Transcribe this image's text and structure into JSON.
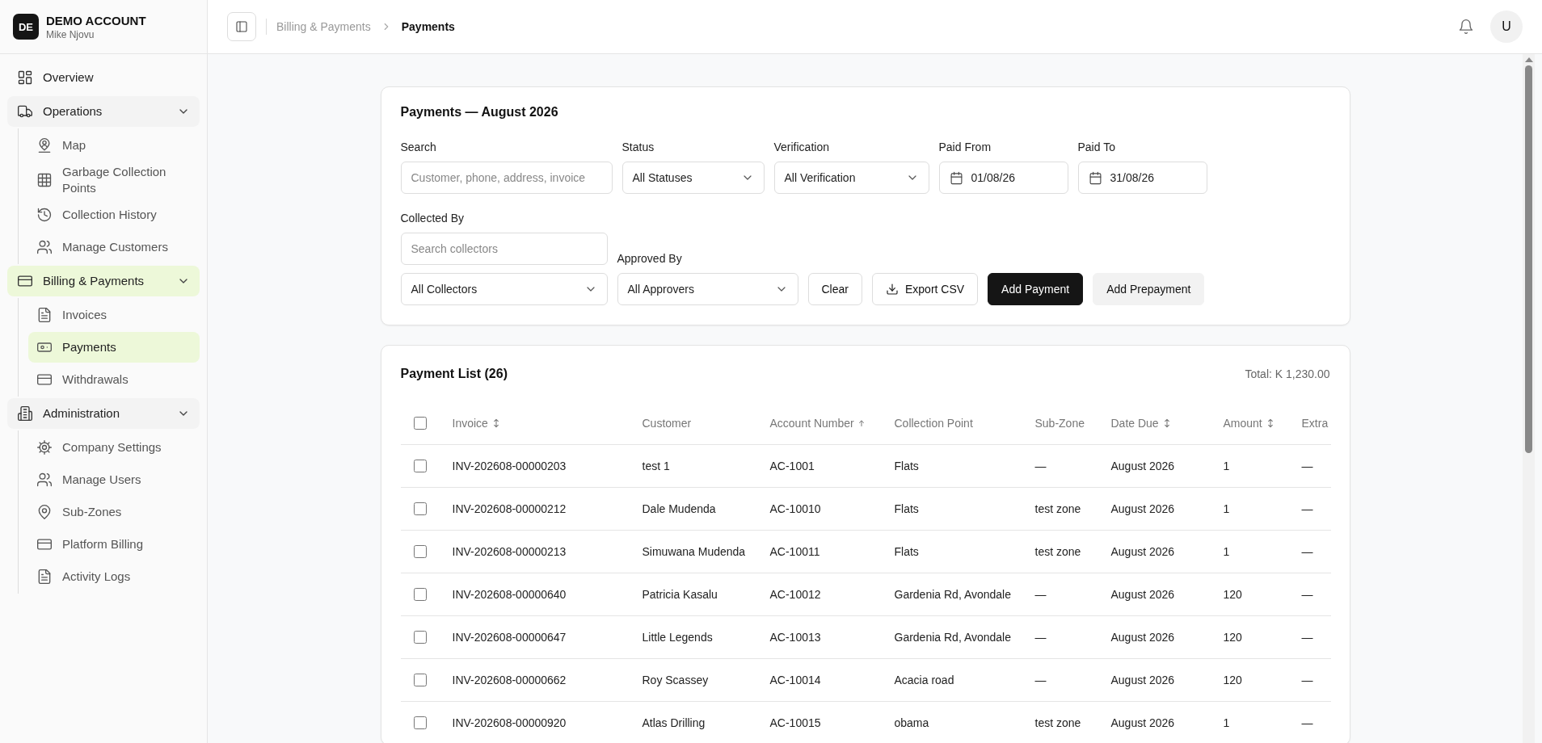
{
  "account": {
    "initials": "DE",
    "name": "DEMO ACCOUNT",
    "user": "Mike Njovu"
  },
  "sidebar": {
    "items": [
      {
        "label": "Overview",
        "selected": false
      },
      {
        "label": "Operations",
        "selected": false,
        "expanded": true,
        "children": [
          {
            "label": "Map",
            "selected": false
          },
          {
            "label": "Garbage Collection Points",
            "selected": false
          },
          {
            "label": "Collection History",
            "selected": false
          },
          {
            "label": "Manage Customers",
            "selected": false
          }
        ]
      },
      {
        "label": "Billing & Payments",
        "selected": true,
        "expanded": true,
        "children": [
          {
            "label": "Invoices",
            "selected": false
          },
          {
            "label": "Payments",
            "selected": true
          },
          {
            "label": "Withdrawals",
            "selected": false
          }
        ]
      },
      {
        "label": "Administration",
        "selected": false,
        "expanded": true,
        "children": [
          {
            "label": "Company Settings",
            "selected": false
          },
          {
            "label": "Manage Users",
            "selected": false
          },
          {
            "label": "Sub-Zones",
            "selected": false
          },
          {
            "label": "Platform Billing",
            "selected": false
          },
          {
            "label": "Activity Logs",
            "selected": false
          }
        ]
      }
    ]
  },
  "header": {
    "breadcrumbs": [
      {
        "label": "Billing & Payments",
        "current": false
      },
      {
        "label": "Payments",
        "current": true
      }
    ],
    "avatar": "U"
  },
  "filters": {
    "title": "Payments — August 2026",
    "fields": [
      {
        "kind": "text",
        "label": "Search",
        "placeholder": "Customer, phone, address, invoice"
      },
      {
        "kind": "select",
        "label": "Status",
        "value": "All Statuses"
      },
      {
        "kind": "select",
        "label": "Verification",
        "value": "All Verification"
      },
      {
        "kind": "date",
        "label": "Paid From",
        "value": "01/08/26"
      },
      {
        "kind": "date",
        "label": "Paid To",
        "value": "31/08/26"
      }
    ],
    "collected_by": {
      "label": "Collected By",
      "placeholder": "Search collectors",
      "value": "All Collectors"
    },
    "approved_by": {
      "label": "Approved By",
      "value": "All Approvers"
    },
    "buttons": [
      {
        "kind": "outline",
        "label": "Clear"
      },
      {
        "kind": "download",
        "label": "Export CSV"
      },
      {
        "kind": "primary",
        "label": "Add Payment"
      },
      {
        "kind": "secondary",
        "label": "Add Prepayment"
      }
    ]
  },
  "table": {
    "title": "Payment List (26)",
    "total": "Total: K 1,230.00",
    "select_all": {
      "checked": false
    },
    "columns": [
      {
        "label": "Invoice",
        "sortable": true,
        "sorted": false
      },
      {
        "label": "Customer",
        "sortable": false,
        "sorted": false
      },
      {
        "label": "Account Number",
        "sortable": true,
        "sorted": true
      },
      {
        "label": "Collection Point",
        "sortable": false,
        "sorted": false
      },
      {
        "label": "Sub-Zone",
        "sortable": false,
        "sorted": false
      },
      {
        "label": "Date Due",
        "sortable": true,
        "sorted": false
      },
      {
        "label": "Amount",
        "sortable": true,
        "sorted": false
      },
      {
        "label": "Extra",
        "sortable": false,
        "sorted": false
      }
    ],
    "rows": [
      {
        "checked": false,
        "cells": [
          "INV-202608-00000203",
          "test 1",
          "AC-1001",
          "Flats",
          "—",
          "August 2026",
          "1",
          "—"
        ]
      },
      {
        "checked": false,
        "cells": [
          "INV-202608-00000212",
          "Dale Mudenda",
          "AC-10010",
          "Flats",
          "test zone",
          "August 2026",
          "1",
          "—"
        ]
      },
      {
        "checked": false,
        "cells": [
          "INV-202608-00000213",
          "Simuwana Mudenda",
          "AC-10011",
          "Flats",
          "test zone",
          "August 2026",
          "1",
          "—"
        ]
      },
      {
        "checked": false,
        "cells": [
          "INV-202608-00000640",
          "Patricia Kasalu",
          "AC-10012",
          "Gardenia Rd, Avondale",
          "—",
          "August 2026",
          "120",
          "—"
        ]
      },
      {
        "checked": false,
        "cells": [
          "INV-202608-00000647",
          "Little Legends",
          "AC-10013",
          "Gardenia Rd, Avondale",
          "—",
          "August 2026",
          "120",
          "—"
        ]
      },
      {
        "checked": false,
        "cells": [
          "INV-202608-00000662",
          "Roy Scassey",
          "AC-10014",
          "Acacia road",
          "—",
          "August 2026",
          "120",
          "—"
        ]
      },
      {
        "checked": false,
        "cells": [
          "INV-202608-00000920",
          "Atlas Drilling",
          "AC-10015",
          "obama",
          "test zone",
          "August 2026",
          "1",
          "—"
        ]
      }
    ]
  }
}
